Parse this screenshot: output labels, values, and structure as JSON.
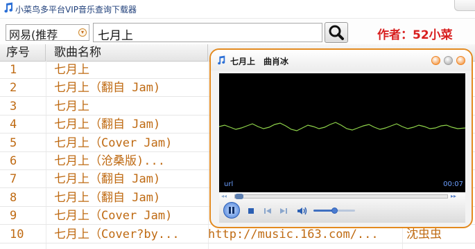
{
  "app": {
    "title": "小菜鸟多平台VIP音乐查询下载器",
    "icon": "music-note-icon"
  },
  "toolbar": {
    "source_select": {
      "value": "网易(推荐"
    },
    "search_input": {
      "value": "七月上"
    },
    "author_label": "作者：52小菜"
  },
  "table": {
    "columns": [
      "序号",
      "歌曲名称"
    ],
    "rows": [
      {
        "num": "1",
        "title": "七月上",
        "url": "",
        "artist": ""
      },
      {
        "num": "2",
        "title": "七月上（翻自 Jam)",
        "url": "",
        "artist": ""
      },
      {
        "num": "3",
        "title": "七月上",
        "url": "",
        "artist": ""
      },
      {
        "num": "4",
        "title": "七月上（翻自 Jam)",
        "url": "",
        "artist": ""
      },
      {
        "num": "5",
        "title": "七月上（Cover Jam)",
        "url": "",
        "artist": ""
      },
      {
        "num": "6",
        "title": "七月上（沧桑版)...",
        "url": "",
        "artist": ""
      },
      {
        "num": "7",
        "title": "七月上（翻自 Jam)",
        "url": "",
        "artist": ""
      },
      {
        "num": "8",
        "title": "七月上（翻自 Jam)",
        "url": "",
        "artist": ""
      },
      {
        "num": "9",
        "title": "七月上（Cover Jam)",
        "url": "",
        "artist": ""
      },
      {
        "num": "10",
        "title": "七月上（Cover?by...",
        "url": "http://music.163.com/...",
        "artist": "沈虫虫"
      }
    ]
  },
  "player": {
    "title": "七月上",
    "artist": "曲肖冰",
    "url_label": "url",
    "time": "00:07",
    "volume_level": 0.5,
    "waveform_color": "#8fd44a",
    "window_buttons_colors": [
      "#f0821e",
      "#a0a0a0",
      "#f0821e"
    ],
    "controls_icons": [
      "pause-icon",
      "stop-icon",
      "previous-icon",
      "next-icon",
      "volume-icon"
    ]
  },
  "colors": {
    "accent_orange": "#e38a1f",
    "song_text": "#bf6a12",
    "author_red": "#d81e1e"
  }
}
